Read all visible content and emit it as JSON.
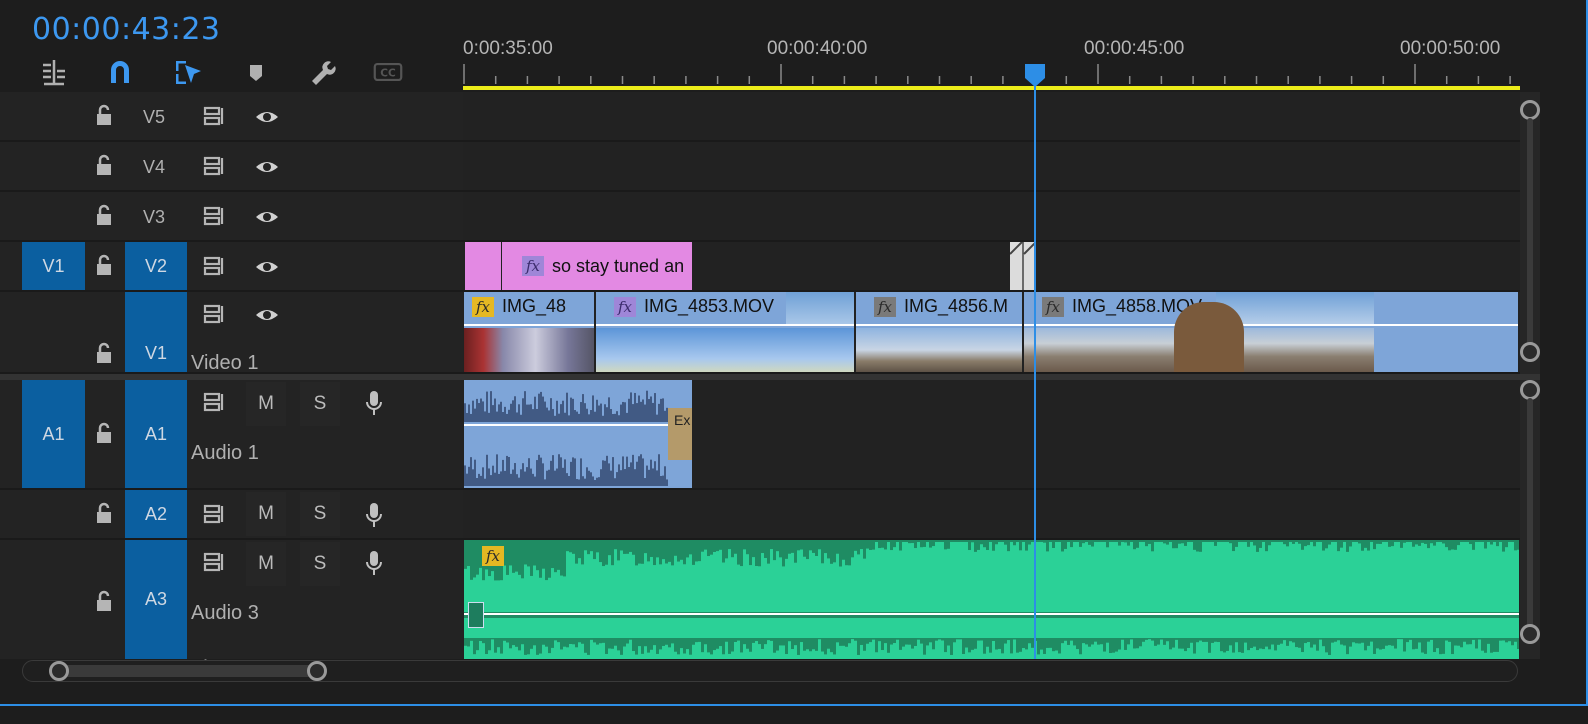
{
  "header": {
    "timecode": "00:00:43:23",
    "tools": [
      {
        "name": "insert-track-icon",
        "active": false
      },
      {
        "name": "snap-magnet-icon",
        "active": true
      },
      {
        "name": "linked-selection-icon",
        "active": true
      },
      {
        "name": "add-marker-icon",
        "active": false
      },
      {
        "name": "wrench-icon",
        "active": false
      },
      {
        "name": "captions-icon",
        "label": "CC",
        "active": false
      }
    ]
  },
  "ruler": {
    "labels": [
      "0:00:35:00",
      "00:00:40:00",
      "00:00:45:00",
      "00:00:50:00"
    ]
  },
  "tracks": {
    "v5": {
      "label": "V5"
    },
    "v4": {
      "label": "V4"
    },
    "v3": {
      "label": "V3"
    },
    "v2": {
      "label": "V2",
      "source_target": "V1"
    },
    "v1": {
      "label": "V1",
      "name": "Video 1"
    },
    "a1": {
      "label": "A1",
      "source_target": "A1",
      "name": "Audio 1",
      "mute": "M",
      "solo": "S"
    },
    "a2": {
      "label": "A2",
      "mute": "M",
      "solo": "S"
    },
    "a3": {
      "label": "A3",
      "name": "Audio 3",
      "mute": "M",
      "solo": "S"
    }
  },
  "clips": {
    "title_clip": "so stay tuned an",
    "img48": "IMG_48",
    "img4853": "IMG_4853.MOV",
    "img4856": "IMG_4856.M",
    "img4858": "IMG_4858.MOV",
    "audio_transition": "Ex"
  },
  "colors": {
    "accent": "#2d8ee6",
    "timecode": "#3d98f0",
    "work_area": "#ecec1a",
    "target_blue": "#0b5fa0",
    "title_clip": "#e389e3",
    "video_clip": "#7ea5d8",
    "audio_clip": "#7ea5d8",
    "music_clip": "#2bd197"
  }
}
